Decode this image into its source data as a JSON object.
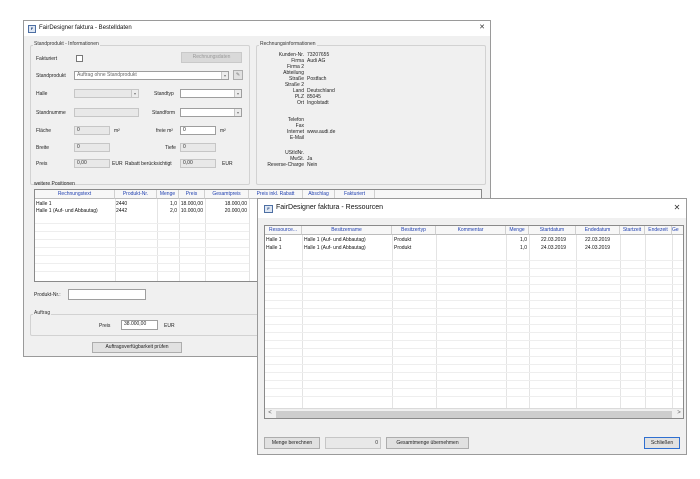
{
  "bg_window": {
    "title": "FairDesigner faktura - Bestelldaten",
    "close_glyph": "✕",
    "standard_group": {
      "title": "Standprodukt - Informationen",
      "fakturiert_label": "Fakturiert",
      "rechnungsdaten_button": "Rechnungsdaten",
      "standprodukt_label": "Standprodukt",
      "standprodukt_value": "Auftrag ohne Standprodukt",
      "halle_label": "Halle",
      "standtyp_label": "Standtyp",
      "standnummer_label": "Standnumme",
      "standform_label": "Standform",
      "flaeche_label": "Fläche",
      "flaeche_value": "0",
      "flaeche_unit": "m²",
      "frei_label": "freie m²",
      "frei_value": "0",
      "frei_unit": "m²",
      "breite_label": "Breite",
      "breite_value": "0",
      "tiefe_label": "Tiefe",
      "tiefe_value": "0",
      "preis_label": "Preis",
      "preis_value": "0,00",
      "preis_unit": "EUR",
      "rabatt_label": "Rabatt berücksichtigt",
      "rabatt_value": "0,00",
      "rabatt_unit": "EUR"
    },
    "rechnung_group": {
      "title": "Rechnungsinformationen",
      "rows": [
        {
          "label": "Kunden-Nr.",
          "value": "73207655"
        },
        {
          "label": "Firma",
          "value": "Audi AG"
        },
        {
          "label": "Firma 2",
          "value": ""
        },
        {
          "label": "Abteilung",
          "value": ""
        },
        {
          "label": "Straße",
          "value": "Postfach"
        },
        {
          "label": "Straße 2",
          "value": ""
        },
        {
          "label": "Land",
          "value": "Deutschland"
        },
        {
          "label": "PLZ",
          "value": "85045"
        },
        {
          "label": "Ort",
          "value": "Ingolstadt"
        }
      ],
      "rows2": [
        {
          "label": "Telefon",
          "value": ""
        },
        {
          "label": "Fax",
          "value": ""
        },
        {
          "label": "Internet",
          "value": "www.audi.de"
        },
        {
          "label": "E-Mail",
          "value": ""
        }
      ],
      "rows3": [
        {
          "label": "UStIdNr.",
          "value": ""
        },
        {
          "label": "MwSt.",
          "value": "Ja"
        },
        {
          "label": "Reverse-Charge",
          "value": "Nein"
        }
      ]
    },
    "weitere": {
      "title": "weitere Positionen",
      "columns": [
        "Rechnungstext",
        "Produkt-Nr.",
        "Menge",
        "Preis",
        "Gesamtpreis",
        "Preis inkl. Rabatt",
        "Abschlag",
        "Fakturiert"
      ],
      "rows": [
        [
          "Halle 1",
          "2440",
          "1,0",
          "18.000,00",
          "18.000,00"
        ],
        [
          "Halle 1 (Auf- und Abbautag)",
          "2442",
          "2,0",
          "10.000,00",
          "20.000,00"
        ]
      ]
    },
    "produktnr_label": "Produkt-Nr.:",
    "auftrag_group": {
      "title": "Auftrag",
      "preis_label": "Preis",
      "preis_value": "38.000,00",
      "preis_unit": "EUR",
      "verfuegbarkeit_button": "Auftragsverfügbarkeit prüfen"
    }
  },
  "fg_window": {
    "title": "FairDesigner faktura - Ressourcen",
    "close_glyph": "✕",
    "columns": [
      "Ressource...",
      "Besitzername",
      "Besitzertyp",
      "Kommentar",
      "Menge",
      "Startdatum",
      "Endedatum",
      "Startzeit",
      "Endezeit",
      "Ge"
    ],
    "rows": [
      [
        "Halle 1",
        "Halle 1 (Auf- und Abbautag)",
        "Produkt",
        "",
        "1,0",
        "22.03.2019",
        "22.03.2019"
      ],
      [
        "Halle 1",
        "Halle 1 (Auf- und Abbautag)",
        "Produkt",
        "",
        "1,0",
        "24.03.2019",
        "24.03.2019"
      ]
    ],
    "scroll_left": "<",
    "scroll_right": ">",
    "menge_berechnen_button": "Menge berechnen",
    "menge_value": "0",
    "gesamtmenge_button": "Gesamtmenge übernehmen",
    "schliessen_button": "Schließen"
  }
}
